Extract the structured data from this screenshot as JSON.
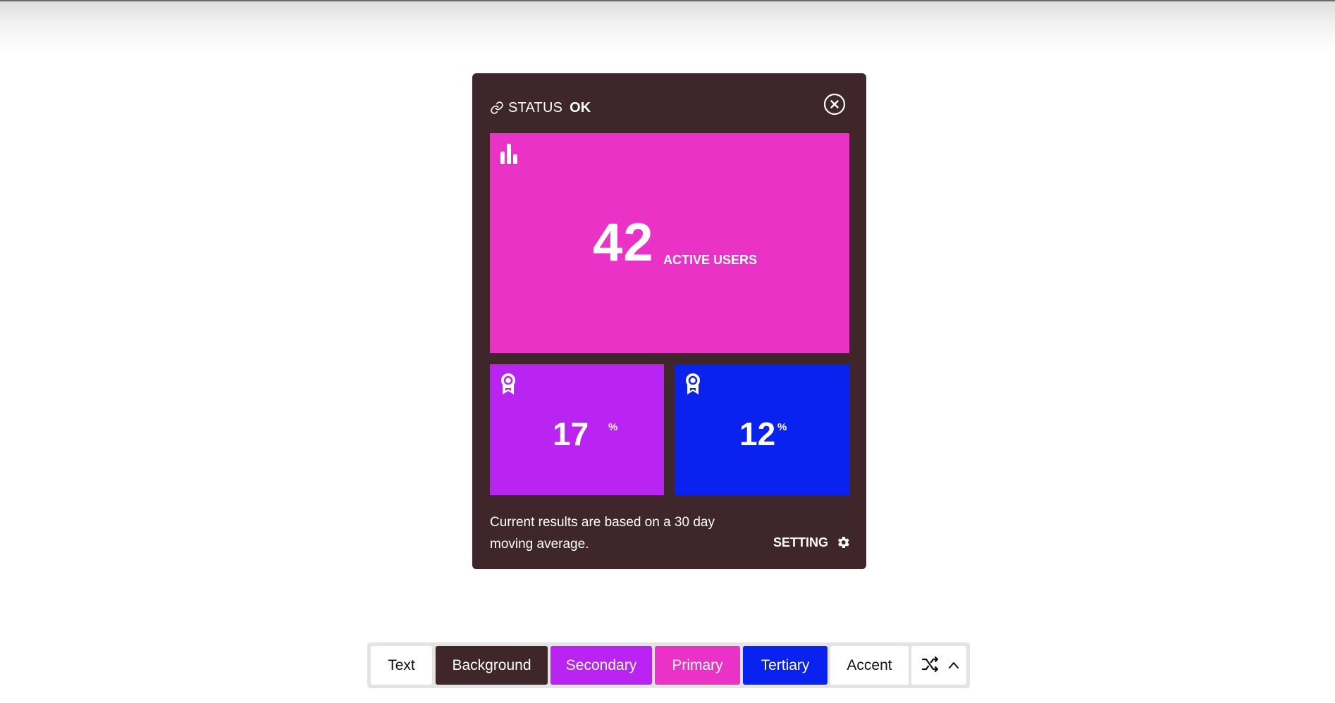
{
  "status": {
    "label": "STATUS",
    "value": "OK",
    "icon": "link-icon"
  },
  "close_icon": "close-circle-icon",
  "main_tile": {
    "icon": "bar-chart-icon",
    "value": "42",
    "label": "ACTIVE USERS",
    "color": "#eb32c6"
  },
  "stat_tiles": [
    {
      "icon": "award-ribbon-icon",
      "value": "17",
      "unit": "%",
      "color": "#b924f2"
    },
    {
      "icon": "award-ribbon-icon",
      "value": "12",
      "unit": "%",
      "color": "#0a22f0"
    }
  ],
  "footnote": "Current results are based on a 30 day moving average.",
  "setting": {
    "label": "SETTING",
    "icon": "gear-icon"
  },
  "palette": {
    "swatches": [
      {
        "label": "Text",
        "color": "#ffffff"
      },
      {
        "label": "Background",
        "color": "#3e262b"
      },
      {
        "label": "Secondary",
        "color": "#b924f2"
      },
      {
        "label": "Primary",
        "color": "#eb32c6"
      },
      {
        "label": "Tertiary",
        "color": "#0a22f0"
      },
      {
        "label": "Accent",
        "color": "#ffffff"
      }
    ],
    "tools": [
      "shuffle-icon",
      "chevron-up-icon"
    ]
  }
}
